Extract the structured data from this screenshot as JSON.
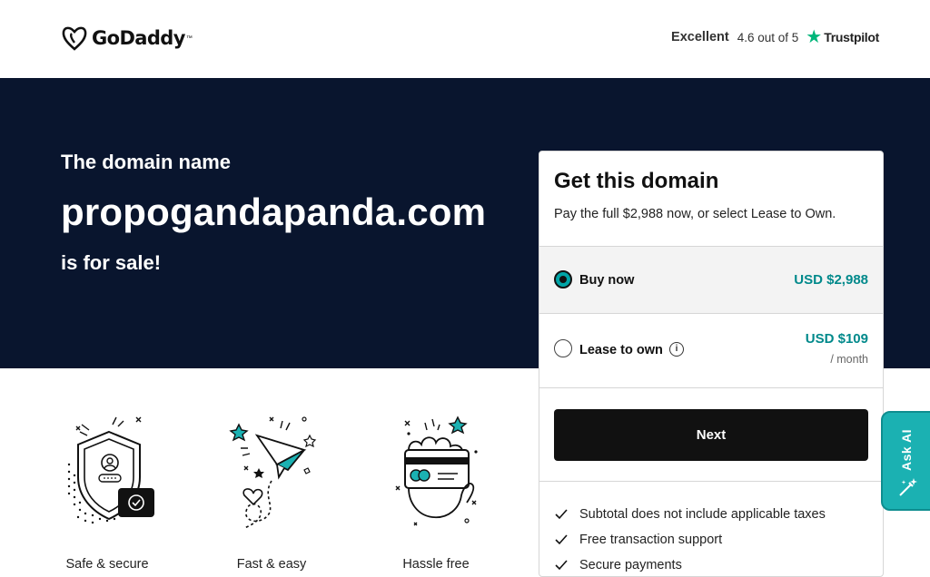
{
  "header": {
    "logo_text": "GoDaddy",
    "trust_label": "Excellent",
    "trust_rating": "4.6 out of 5",
    "trust_brand": "Trustpilot"
  },
  "hero": {
    "pre": "The domain name",
    "domain": "propogandapanda.com",
    "post": "is for sale!"
  },
  "card": {
    "title": "Get this domain",
    "subtitle": "Pay the full $2,988 now, or select Lease to Own.",
    "options": [
      {
        "label": "Buy now",
        "price": "USD $2,988",
        "selected": true
      },
      {
        "label": "Lease to own",
        "price": "USD $109",
        "per": "/ month",
        "selected": false
      }
    ],
    "next_label": "Next",
    "features": [
      "Subtotal does not include applicable taxes",
      "Free transaction support",
      "Secure payments"
    ]
  },
  "benefits": [
    {
      "label": "Safe & secure",
      "icon": "shield-icon"
    },
    {
      "label": "Fast & easy",
      "icon": "paper-plane-icon"
    },
    {
      "label": "Hassle free",
      "icon": "hand-card-icon"
    }
  ],
  "ask_ai": {
    "label": "Ask AI"
  },
  "colors": {
    "hero_bg": "#09152e",
    "accent": "#00a4a6",
    "trustpilot_green": "#00b67a"
  }
}
